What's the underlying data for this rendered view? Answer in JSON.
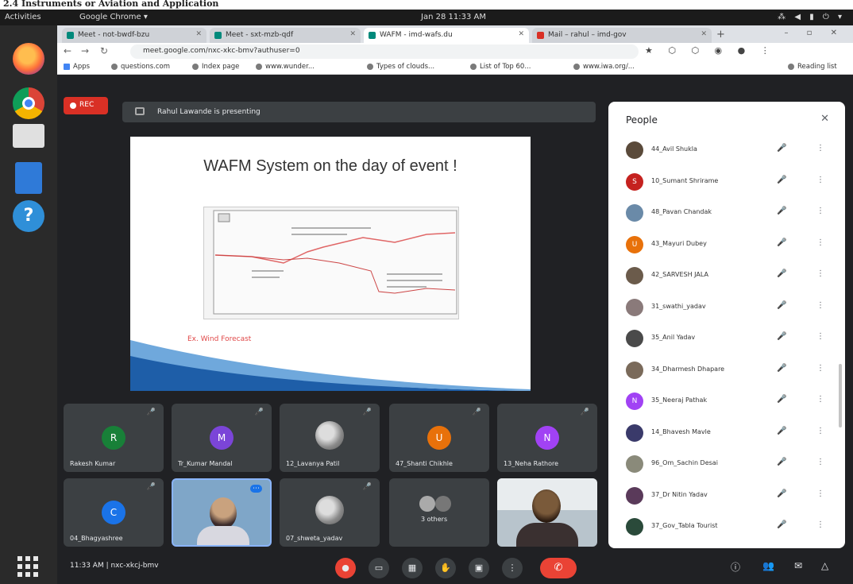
{
  "caption": "2.4 Instruments or Aviation and Application",
  "topbar": {
    "activities": "Activities",
    "app": "Google Chrome ▾",
    "clock": "Jan 28 11:33 AM",
    "indicators": "⁂ ◀ ▮ ⏻ ▾"
  },
  "browser": {
    "tabs": [
      {
        "label": "Meet - not-bwdf-bzu"
      },
      {
        "label": "Meet - sxt-mzb-qdf"
      },
      {
        "label": "WAFM - imd-wafs.du"
      },
      {
        "label": "Mail – rahul – imd-gov"
      }
    ],
    "new_tab": "+",
    "window_controls": "– ▫ ✕",
    "url": "meet.google.com/nxc-xkc-bmv?authuser=0",
    "ext_icons": "★ ⬡ ⬡ ◉ ● ⋮",
    "bookmarks": [
      "Apps",
      "questions.com",
      "Index page",
      "www.wunder...",
      "Types of clouds...",
      "List of Top 60...",
      "www.iwa.org/...",
      "Reading list"
    ]
  },
  "meet": {
    "rec_label": "REC",
    "presenting_text": "Rahul Lawande is presenting",
    "slide_title": "WAFM System on the day of event !",
    "slide_caption": "Ex. Wind Forecast",
    "tiles": [
      {
        "name": "Rakesh Kumar",
        "initial": "R",
        "color": "#188038"
      },
      {
        "name": "Tr_Kumar Mandal",
        "initial": "M",
        "color": "#7b45d8"
      },
      {
        "name": "12_Lavanya Patil",
        "initial": "",
        "color": ""
      },
      {
        "name": "47_Shanti Chikhle",
        "initial": "U",
        "color": "#e8710a"
      },
      {
        "name": "13_Neha Rathore",
        "initial": "N",
        "color": "#a142f4"
      },
      {
        "name": "04_Bhagyashree",
        "initial": "C",
        "color": "#1a73e8"
      },
      {
        "name": "",
        "initial": "",
        "color": ""
      },
      {
        "name": "07_shweta_yadav",
        "initial": "",
        "color": ""
      },
      {
        "name": "3 others",
        "initial": "",
        "color": ""
      },
      {
        "name": "",
        "initial": "",
        "color": ""
      }
    ],
    "mic_icon": "🎤",
    "meeting_info": "11:33 AM | nxc-xkcj-bmv",
    "end_call": "✆",
    "controls": [
      "●",
      "▭",
      "▦",
      "✋",
      "▣",
      "⋮"
    ],
    "right_controls": [
      "ⓘ",
      "👥",
      "✉",
      "△"
    ],
    "people": {
      "title": "People",
      "close": "✕",
      "mic_icon": "🎤",
      "more_icon": "⋮",
      "list": [
        {
          "name": "44_Avil Shukla",
          "initial": "",
          "color": "#5a4a3a"
        },
        {
          "name": "10_Sumant Shrirame",
          "initial": "S",
          "color": "#c5221f"
        },
        {
          "name": "48_Pavan Chandak",
          "initial": "",
          "color": "#6a8aa8"
        },
        {
          "name": "43_Mayuri Dubey",
          "initial": "U",
          "color": "#e8710a"
        },
        {
          "name": "42_SARVESH JALA",
          "initial": "",
          "color": "#6b5b4b"
        },
        {
          "name": "31_swathi_yadav",
          "initial": "",
          "color": "#8a7a7a"
        },
        {
          "name": "35_Anil Yadav",
          "initial": "",
          "color": "#4a4a4a"
        },
        {
          "name": "34_Dharmesh Dhapare",
          "initial": "",
          "color": "#7a6a5a"
        },
        {
          "name": "35_Neeraj Pathak",
          "initial": "N",
          "color": "#a142f4"
        },
        {
          "name": "14_Bhavesh Mavle",
          "initial": "",
          "color": "#3a3a6a"
        },
        {
          "name": "96_Om_Sachin Desai",
          "initial": "",
          "color": "#8a8a7a"
        },
        {
          "name": "37_Dr Nitin Yadav",
          "initial": "",
          "color": "#5a3a5a"
        },
        {
          "name": "37_Gov_Tabla Tourist",
          "initial": "",
          "color": "#2a4a3a"
        }
      ]
    }
  }
}
